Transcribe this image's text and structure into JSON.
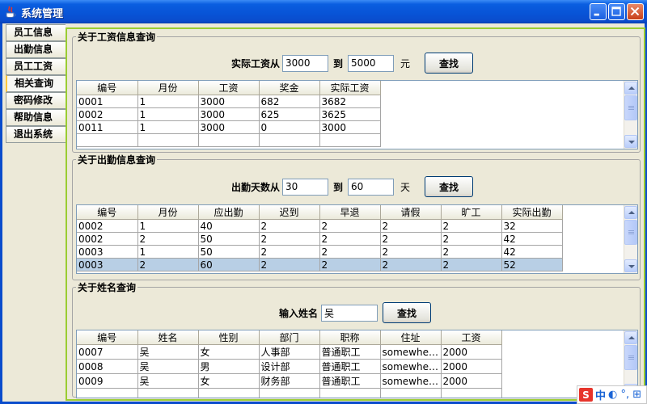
{
  "window": {
    "title": "系统管理"
  },
  "tabs": [
    {
      "label": "员工信息"
    },
    {
      "label": "出勤信息"
    },
    {
      "label": "员工工资"
    },
    {
      "label": "相关查询",
      "active": true
    },
    {
      "label": "密码修改"
    },
    {
      "label": "帮助信息"
    },
    {
      "label": "退出系统"
    }
  ],
  "salary_query": {
    "legend": "关于工资信息查询",
    "label_from": "实际工资从",
    "from_value": "3000",
    "label_to": "到",
    "to_value": "5000",
    "unit": "元",
    "search_label": "查找",
    "columns": [
      "编号",
      "月份",
      "工资",
      "奖金",
      "实际工资"
    ],
    "rows": [
      [
        "0001",
        "1",
        "3000",
        "682",
        "3682"
      ],
      [
        "0002",
        "1",
        "3000",
        "625",
        "3625"
      ],
      [
        "0011",
        "1",
        "3000",
        "0",
        "3000"
      ],
      [
        "",
        "",
        "",
        "",
        ""
      ]
    ]
  },
  "attendance_query": {
    "legend": "关于出勤信息查询",
    "label_from": "出勤天数从",
    "from_value": "30",
    "label_to": "到",
    "to_value": "60",
    "unit": "天",
    "search_label": "查找",
    "columns": [
      "编号",
      "月份",
      "应出勤",
      "迟到",
      "早退",
      "请假",
      "旷工",
      "实际出勤"
    ],
    "rows": [
      [
        "0002",
        "1",
        "40",
        "2",
        "2",
        "2",
        "2",
        "32"
      ],
      [
        "0002",
        "2",
        "50",
        "2",
        "2",
        "2",
        "2",
        "42"
      ],
      [
        "0003",
        "1",
        "50",
        "2",
        "2",
        "2",
        "2",
        "42"
      ],
      [
        "0003",
        "2",
        "60",
        "2",
        "2",
        "2",
        "2",
        "52"
      ]
    ],
    "selected_row": 3
  },
  "name_query": {
    "legend": "关于姓名查询",
    "label": "输入姓名",
    "name_value": "吴",
    "search_label": "查找",
    "columns": [
      "编号",
      "姓名",
      "性别",
      "部门",
      "职称",
      "住址",
      "工资"
    ],
    "rows": [
      [
        "0007",
        "吴",
        "女",
        "人事部",
        "普通职工",
        "somewher...",
        "2000"
      ],
      [
        "0008",
        "吴",
        "男",
        "设计部",
        "普通职工",
        "somewher...",
        "2000"
      ],
      [
        "0009",
        "吴",
        "女",
        "财务部",
        "普通职工",
        "somewher...",
        "2000"
      ],
      [
        "",
        "",
        "",
        "",
        "",
        "",
        ""
      ]
    ]
  },
  "ime_bar": {
    "brand": "S",
    "mode": "中",
    "extras": "◐ °, ⊞"
  },
  "colors": {
    "titlebar": "#0853d6",
    "panel_border": "#9acd32",
    "selected_row": "#b8cfe5",
    "active_tab_accent": "#ffc83c"
  }
}
